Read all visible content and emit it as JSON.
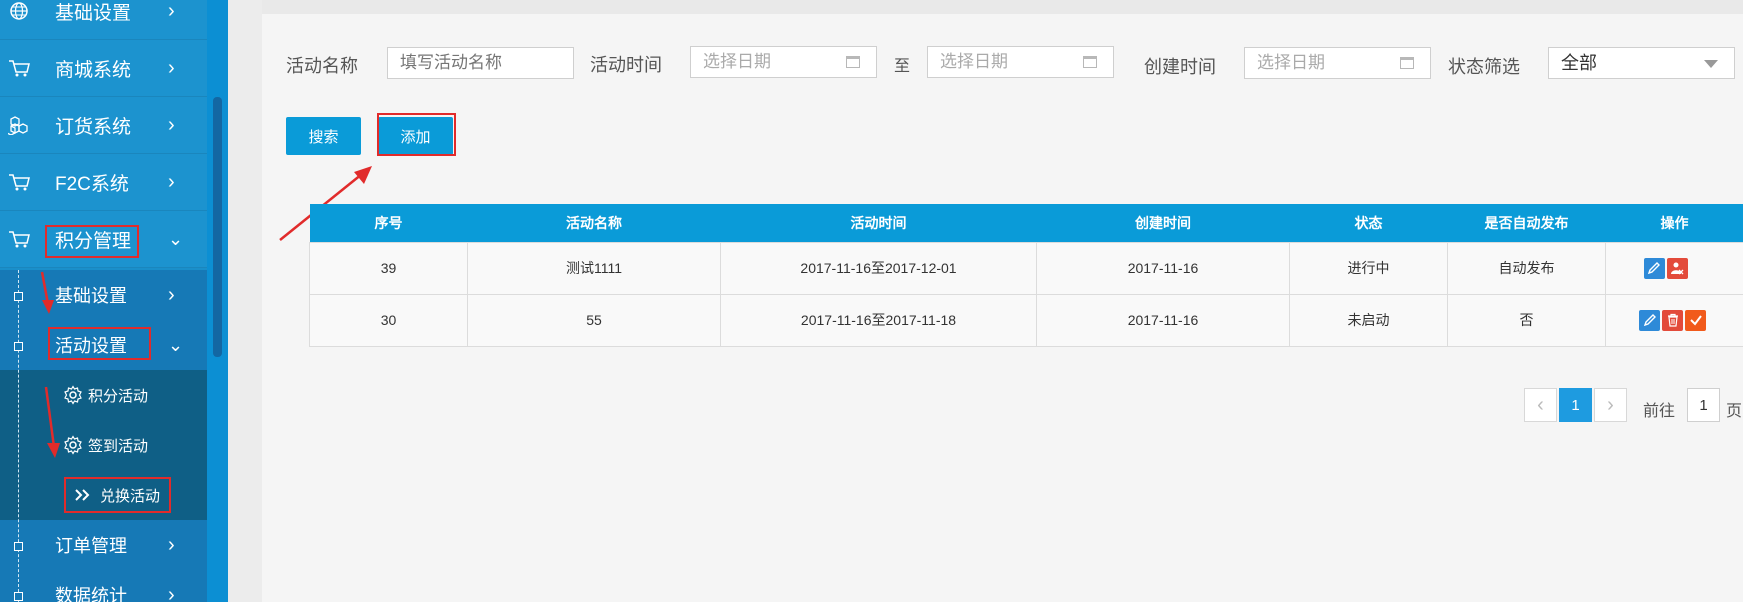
{
  "sidebar": {
    "items": [
      {
        "label": "基础设置",
        "icon": "globe-icon"
      },
      {
        "label": "商城系统",
        "icon": "cart-icon"
      },
      {
        "label": "订货系统",
        "icon": "boxes-icon"
      },
      {
        "label": "F2C系统",
        "icon": "cart-icon"
      },
      {
        "label": "积分管理",
        "icon": "cart-icon"
      }
    ],
    "sub_items": [
      {
        "label": "基础设置"
      },
      {
        "label": "活动设置"
      }
    ],
    "leaf_items": [
      {
        "label": "积分活动",
        "icon": "gear-icon"
      },
      {
        "label": "签到活动",
        "icon": "gear-icon"
      },
      {
        "label": "兑换活动",
        "icon": "double-chevron-icon"
      }
    ],
    "more_items": [
      {
        "label": "订单管理"
      },
      {
        "label": "数据统计"
      }
    ]
  },
  "filters": {
    "name_label": "活动名称",
    "name_placeholder": "填写活动名称",
    "time_label": "活动时间",
    "start_placeholder": "选择日期",
    "range_sep": "至",
    "end_placeholder": "选择日期",
    "created_label": "创建时间",
    "created_placeholder": "选择日期",
    "status_label": "状态筛选",
    "status_value": "全部"
  },
  "actions": {
    "search_label": "搜索",
    "add_label": "添加"
  },
  "table": {
    "headers": [
      "序号",
      "活动名称",
      "活动时间",
      "创建时间",
      "状态",
      "是否自动发布",
      "操作"
    ],
    "rows": [
      {
        "id": "39",
        "name": "测试1111",
        "period": "2017-11-16至2017-12-01",
        "created": "2017-11-16",
        "status": "进行中",
        "auto": "自动发布"
      },
      {
        "id": "30",
        "name": "55",
        "period": "2017-11-16至2017-11-18",
        "created": "2017-11-16",
        "status": "未启动",
        "auto": "否"
      }
    ]
  },
  "pagination": {
    "current": "1",
    "goto_label": "前往",
    "goto_value": "1",
    "page_suffix": "页"
  },
  "colors": {
    "accent": "#0a9bd8",
    "sidebar": "#1a8fca",
    "highlight": "#e12b2b"
  }
}
